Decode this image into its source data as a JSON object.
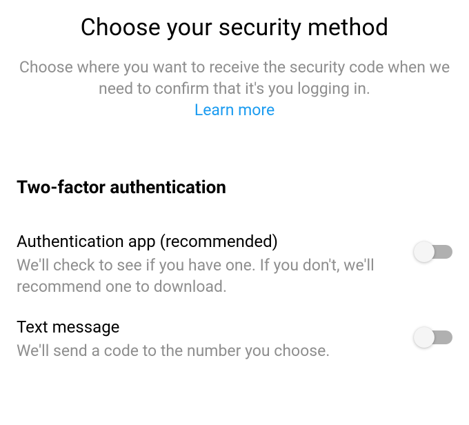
{
  "header": {
    "title": "Choose your security method",
    "subtitle": "Choose where you want to receive the security code when we need to confirm that it's you logging in.",
    "learn_more": "Learn more"
  },
  "section": {
    "title": "Two-factor authentication"
  },
  "options": {
    "auth_app": {
      "title": "Authentication app (recommended)",
      "desc": "We'll check to see if you have one. If you don't, we'll recommend one to download.",
      "enabled": false
    },
    "text_message": {
      "title": "Text message",
      "desc": "We'll send a code to the number you choose.",
      "enabled": false
    }
  }
}
